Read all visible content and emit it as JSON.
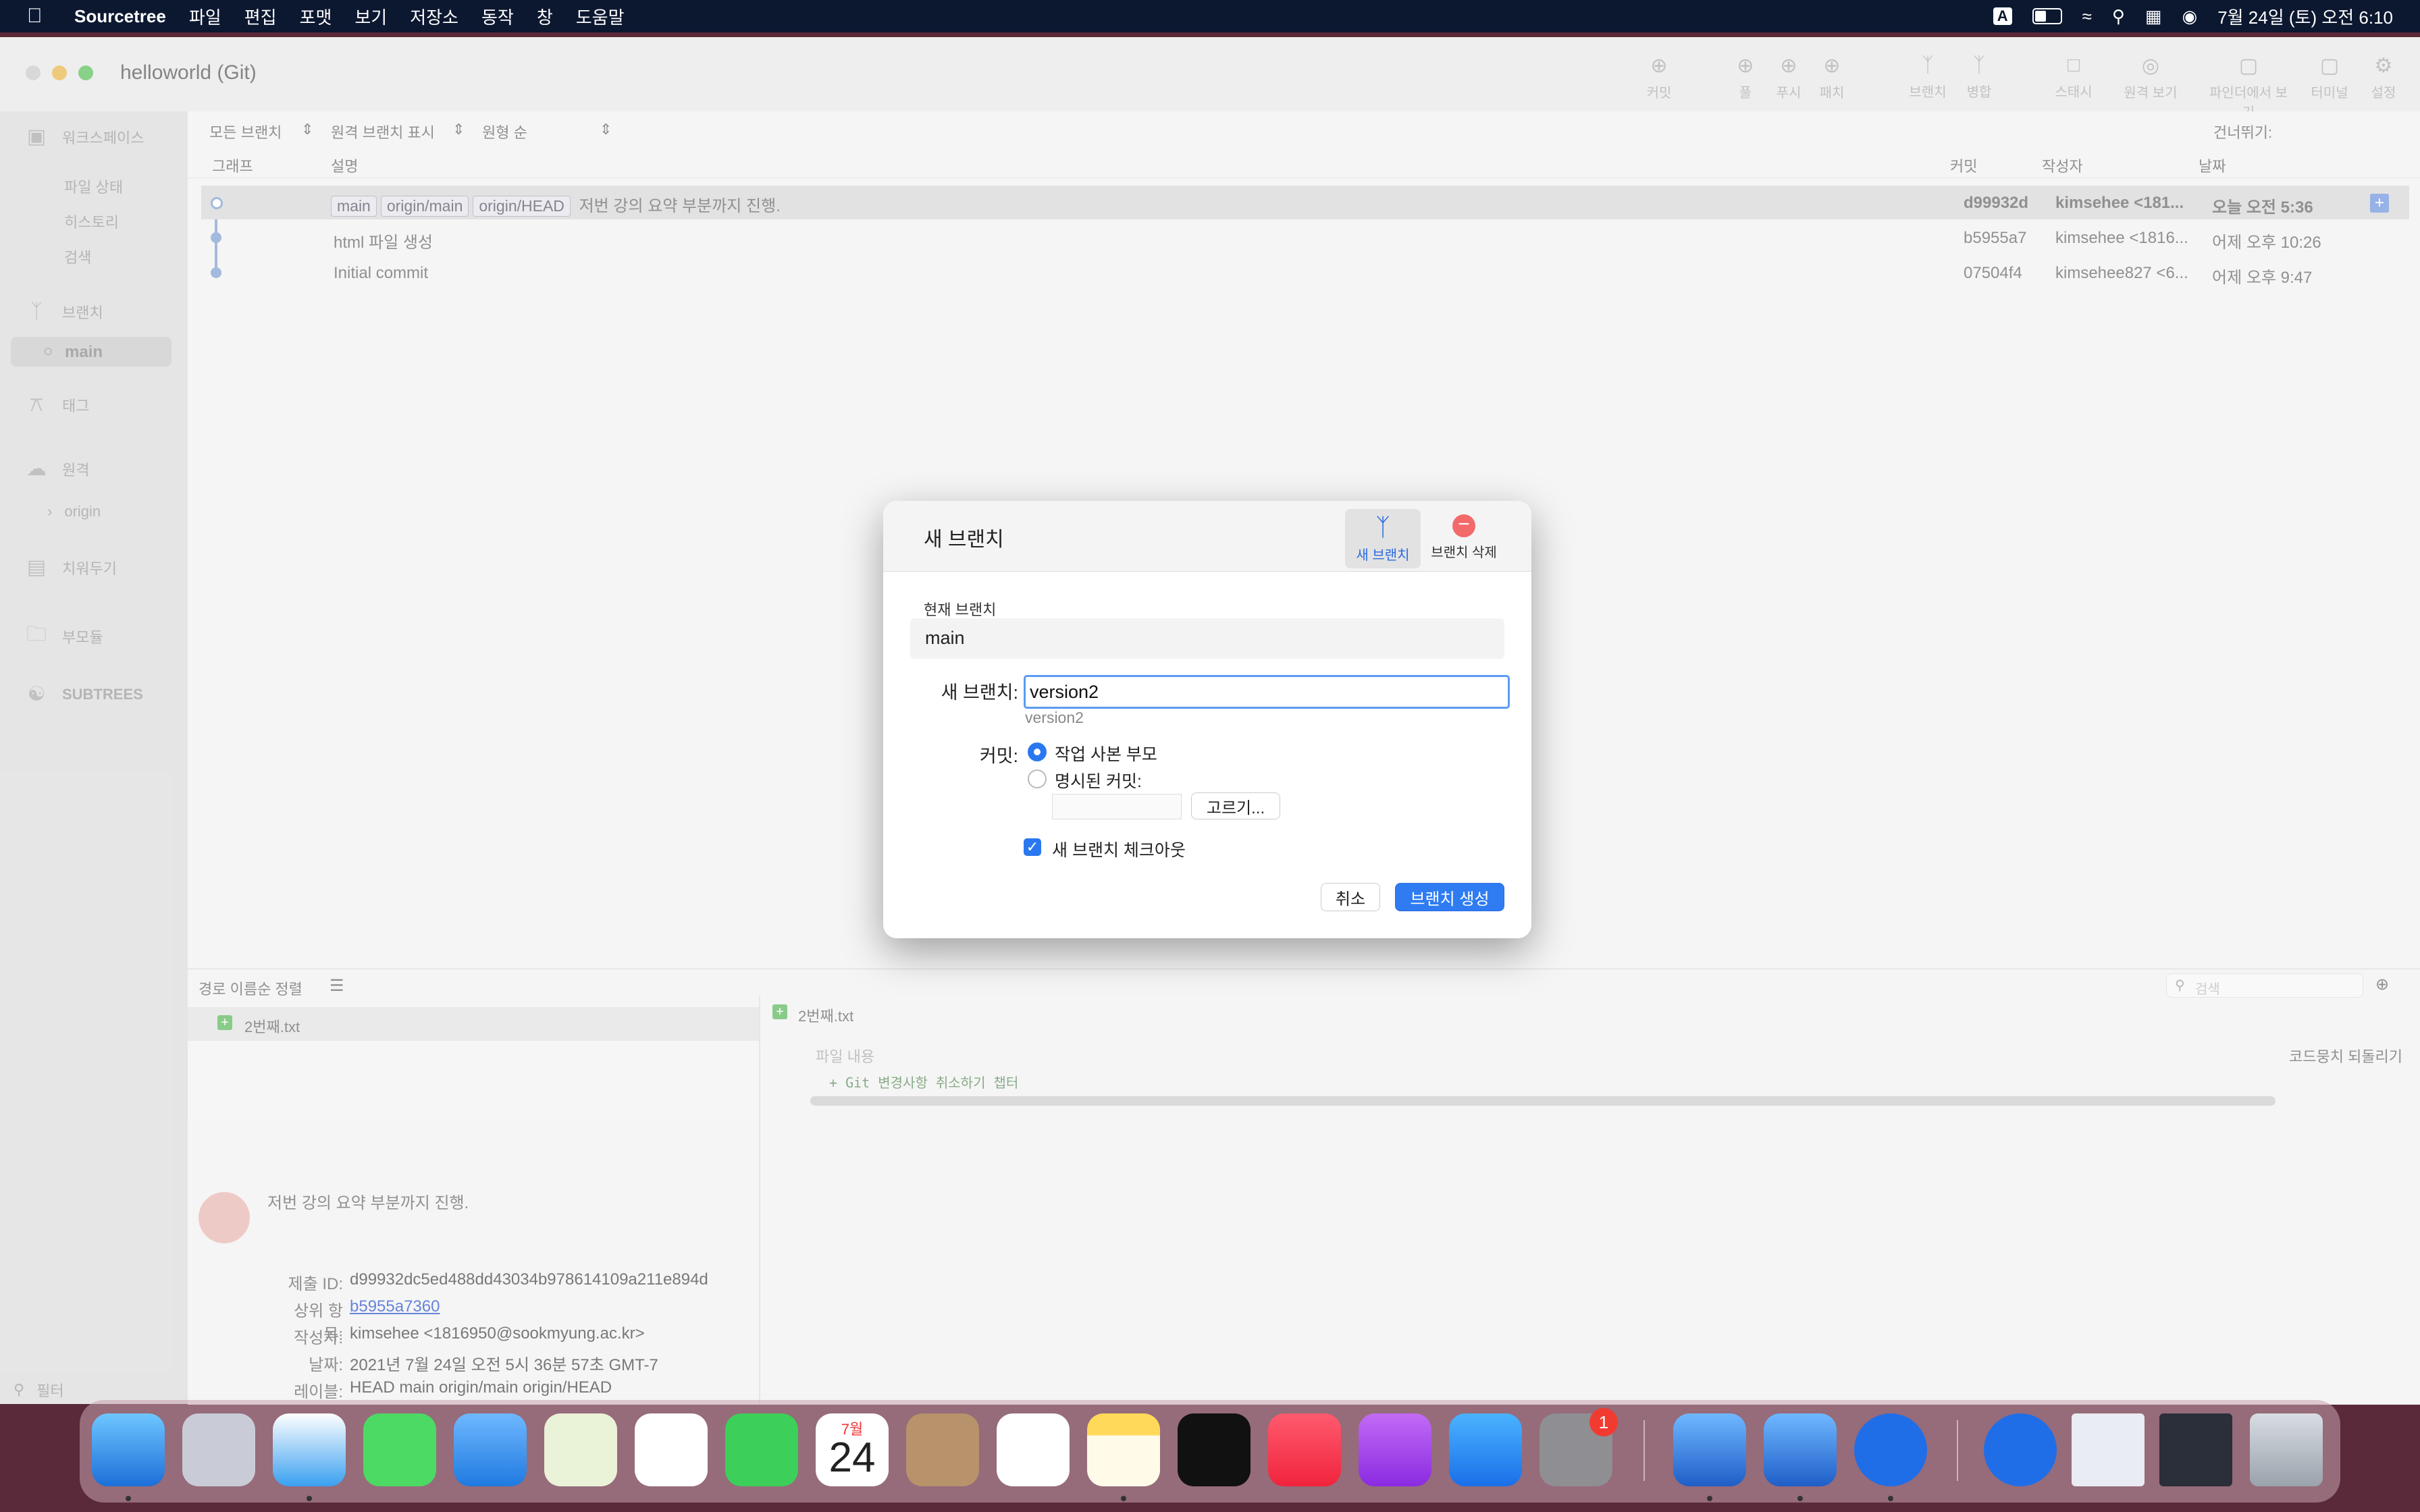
{
  "menubar": {
    "app_name": "Sourcetree",
    "items": [
      "파일",
      "편집",
      "포맷",
      "보기",
      "저장소",
      "동작",
      "창",
      "도움말"
    ],
    "input_source": "A",
    "datetime": "7월 24일 (토) 오전 6:10"
  },
  "window": {
    "title": "helloworld (Git)",
    "toolbar": [
      "커밋",
      "풀",
      "푸시",
      "패치",
      "브랜치",
      "병합",
      "스태시",
      "원격 보기",
      "파인더에서 보기",
      "터미널",
      "설정"
    ]
  },
  "sidebar": {
    "workspace": "워크스페이스",
    "file_status": "파일 상태",
    "history": "히스토리",
    "search": "검색",
    "branches": "브랜치",
    "main_branch": "main",
    "tags": "태그",
    "remotes": "원격",
    "origin": "origin",
    "stashes": "치워두기",
    "submodules": "부모듈",
    "subtrees": "SUBTREES"
  },
  "filters": {
    "all_branches": "모든 브랜치",
    "show_remote": "원격 브랜치 표시",
    "order": "원형 순",
    "jump": "건너뛰기:"
  },
  "columns": {
    "graph": "그래프",
    "description": "설명",
    "commit": "커밋",
    "author": "작성자",
    "date": "날짜"
  },
  "commits": [
    {
      "tags": [
        "main",
        "origin/main",
        "origin/HEAD"
      ],
      "message": "저번 강의 요약 부분까지 진행.",
      "hash": "d99932d",
      "author": "kimsehee <181...",
      "date": "오늘 오전 5:36"
    },
    {
      "tags": [],
      "message": "html 파일 생성",
      "hash": "b5955a7",
      "author": "kimsehee <1816...",
      "date": "어제 오후 10:26"
    },
    {
      "tags": [],
      "message": "Initial commit",
      "hash": "07504f4",
      "author": "kimsehee827 <6...",
      "date": "어제 오후 9:47"
    }
  ],
  "lower": {
    "sort": "경로 이름순 정렬",
    "file": "2번째.txt",
    "file_right": "2번째.txt",
    "content_label": "파일 내용",
    "discard": "코드뭉치 되돌리기",
    "search_placeholder": "검색",
    "diff_line": "+ Git 변경사항 취소하기 챕터",
    "commit_message": "저번 강의 요약 부분까지 진행.",
    "labels": [
      "제출 ID:",
      "상위 항목:",
      "작성자:",
      "날짜:",
      "레이블:"
    ],
    "commit_id": "d99932dc5ed488dd43034b978614109a211e894d",
    "parent": "b5955a7360",
    "author": "kimsehee <1816950@sookmyung.ac.kr>",
    "date": "2021년 7월 24일 오전 5시 36분 57초 GMT-7",
    "label_value": "HEAD main origin/main origin/HEAD",
    "filter": "필터"
  },
  "dialog": {
    "title": "새 브랜치",
    "tab_new": "새 브랜치",
    "tab_delete": "브랜치 삭제",
    "current_branch_label": "현재 브랜치",
    "current_branch": "main",
    "new_branch_label": "새 브랜치:",
    "new_branch_value": "version2",
    "preview": "version2",
    "commit_label": "커밋:",
    "option_working_copy": "작업 사본 부모",
    "option_specified": "명시된 커밋:",
    "choose": "고르기...",
    "checkout": "새 브랜치 체크아웃",
    "cancel": "취소",
    "create": "브랜치 생성"
  },
  "dock": {
    "calendar_month": "7월",
    "calendar_day": "24",
    "settings_badge": "1"
  }
}
